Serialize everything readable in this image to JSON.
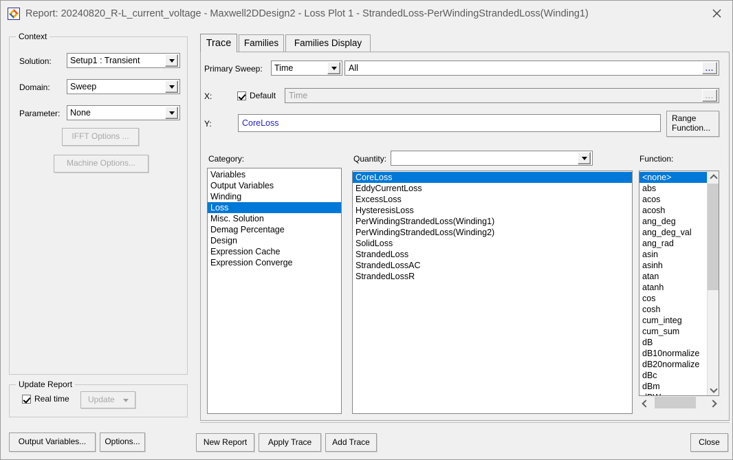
{
  "window": {
    "title": "Report: 20240820_R-L_current_voltage - Maxwell2DDesign2 - Loss Plot 1 - StrandedLoss-PerWindingStrandedLoss(Winding1)",
    "close_label": "×",
    "icon": "maxwell-app-icon"
  },
  "colors": {
    "selection": "#0078D7",
    "expression_text": "#2323C8",
    "dialog_bg": "#F0F0F0",
    "title_text": "#5B5B5B"
  },
  "context": {
    "group_title": "Context",
    "solution_label": "Solution:",
    "solution_value": "Setup1 : Transient",
    "domain_label": "Domain:",
    "domain_value": "Sweep",
    "parameter_label": "Parameter:",
    "parameter_value": "None",
    "ifft_button": "IFFT Options ...",
    "machine_button": "Machine Options..."
  },
  "update_report": {
    "group_title": "Update Report",
    "realtime_label": "Real time",
    "realtime_checked": true,
    "update_button": "Update"
  },
  "bottom_left_buttons": [
    {
      "label": "Output Variables...",
      "accel": "O"
    },
    {
      "label": "Options...",
      "accel": "O"
    }
  ],
  "tabs": [
    {
      "label": "Trace",
      "active": true
    },
    {
      "label": "Families",
      "active": false
    },
    {
      "label": "Families Display",
      "active": false
    }
  ],
  "trace": {
    "primary_sweep_label": "Primary Sweep:",
    "primary_sweep_value": "Time",
    "primary_sweep_range": "All",
    "primary_sweep_range_dots": "...",
    "x_label": "X:",
    "x_default_label": "Default",
    "x_default_checked": true,
    "x_value_placeholder": "Time",
    "x_dots": "...",
    "y_label": "Y:",
    "y_value": "CoreLoss",
    "range_function_button_line1": "Range",
    "range_function_button_line2": "Function..."
  },
  "category": {
    "label": "Category:",
    "items": [
      "Variables",
      "Output Variables",
      "Winding",
      "Loss",
      "Misc. Solution",
      "Demag Percentage",
      "Design",
      "Expression Cache",
      "Expression Converge"
    ],
    "selected_index": 3
  },
  "quantity": {
    "label": "Quantity:",
    "combo_value": "",
    "items": [
      "CoreLoss",
      "EddyCurrentLoss",
      "ExcessLoss",
      "HysteresisLoss",
      "PerWindingStrandedLoss(Winding1)",
      "PerWindingStrandedLoss(Winding2)",
      "SolidLoss",
      "StrandedLoss",
      "StrandedLossAC",
      "StrandedLossR"
    ],
    "selected_index": 0
  },
  "function": {
    "label": "Function:",
    "items": [
      "<none>",
      "abs",
      "acos",
      "acosh",
      "ang_deg",
      "ang_deg_val",
      "ang_rad",
      "asin",
      "asinh",
      "atan",
      "atanh",
      "cos",
      "cosh",
      "cum_integ",
      "cum_sum",
      "dB",
      "dB10normalize",
      "dB20normalize",
      "dBc",
      "dBm",
      "dBW"
    ],
    "selected_index": 0
  },
  "bottom_buttons": [
    {
      "label": "New Report",
      "accel": "N"
    },
    {
      "label": "Apply Trace",
      "accel": "T"
    },
    {
      "label": "Add Trace",
      "accel": "A"
    },
    {
      "label": "Close",
      "accel": "C"
    }
  ]
}
